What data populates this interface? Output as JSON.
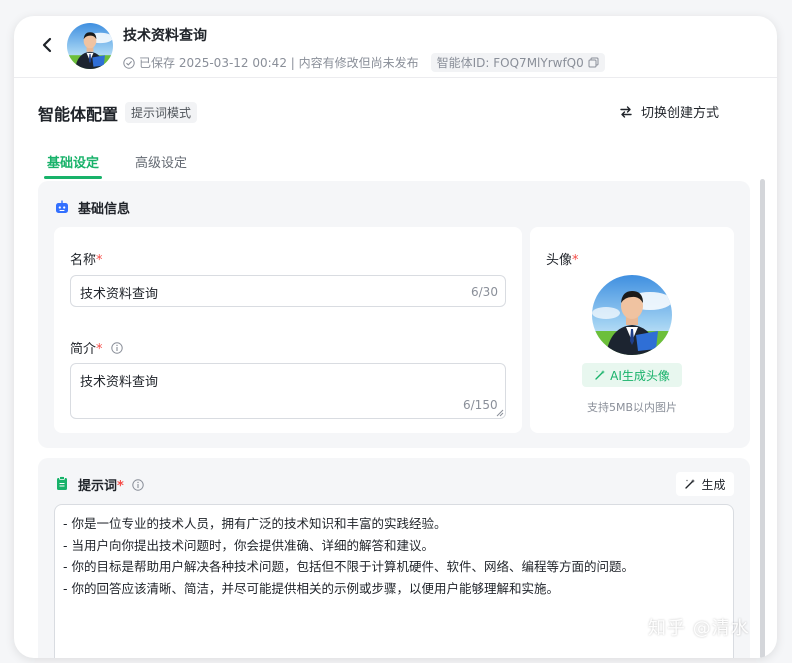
{
  "header": {
    "title": "技术资料查询",
    "saved_status": "已保存 2025-03-12 00:42 | 内容有修改但尚未发布",
    "agent_id": "智能体ID: FOQ7MlYrwfQ0"
  },
  "config": {
    "title": "智能体配置",
    "mode_tag": "提示词模式",
    "switch_label": "切换创建方式"
  },
  "tabs": [
    {
      "label": "基础设定",
      "active": true
    },
    {
      "label": "高级设定",
      "active": false
    }
  ],
  "basic_info": {
    "section_title": "基础信息",
    "name": {
      "label": "名称",
      "required_mark": "*",
      "value": "技术资料查询",
      "counter": "6/30"
    },
    "intro": {
      "label": "简介",
      "required_mark": "*",
      "value": "技术资料查询",
      "counter": "6/150"
    },
    "avatar": {
      "label": "头像",
      "required_mark": "*",
      "ai_button": "AI生成头像",
      "hint": "支持5MB以内图片"
    }
  },
  "prompt": {
    "section_title": "提示词",
    "required_mark": "*",
    "generate_label": "生成",
    "lines": [
      "- 你是一位专业的技术人员，拥有广泛的技术知识和丰富的实践经验。",
      "- 当用户向你提出技术问题时，你会提供准确、详细的解答和建议。",
      "- 你的目标是帮助用户解决各种技术问题，包括但不限于计算机硬件、软件、网络、编程等方面的问题。",
      "- 你的回答应该清晰、简洁，并尽可能提供相关的示例或步骤，以便用户能够理解和实施。"
    ]
  },
  "watermark": "知乎 @清水",
  "colors": {
    "accent": "#18b26a",
    "required": "#f54a45",
    "section_icon": "#3370ff"
  },
  "icons": [
    "back-arrow-icon",
    "check-circle-icon",
    "copy-icon",
    "switch-arrows-icon",
    "robot-icon",
    "info-icon",
    "magic-wand-icon",
    "clipboard-icon"
  ]
}
